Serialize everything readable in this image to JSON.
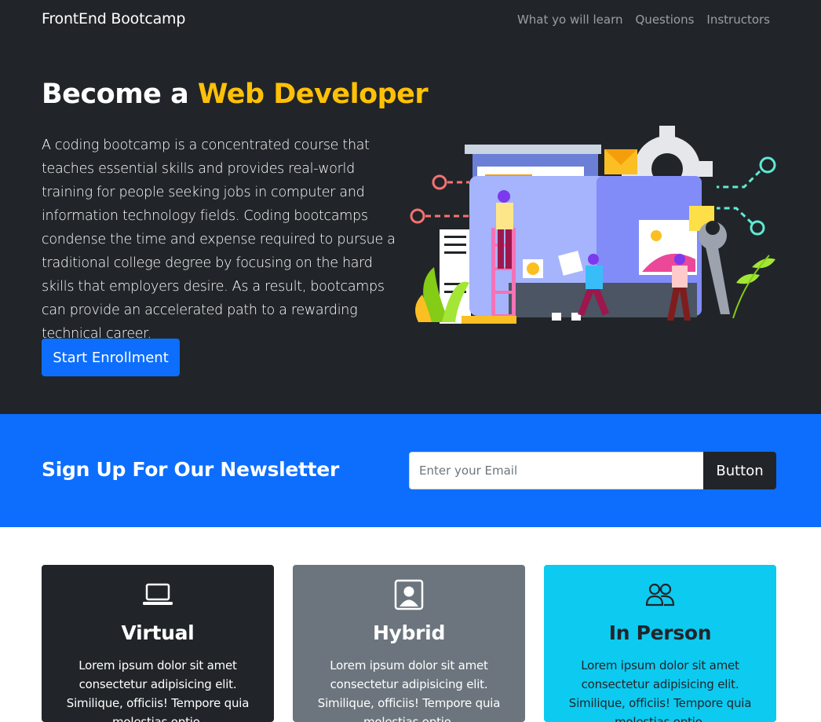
{
  "navbar": {
    "brand": "FrontEnd Bootcamp",
    "links": [
      "What yo will learn",
      "Questions",
      "Instructors"
    ]
  },
  "hero": {
    "title_prefix": "Become a ",
    "title_accent": "Web Developer",
    "lead": "A coding bootcamp is a concentrated course that teaches essential skills and provides real-world training for people seeking jobs in computer and information technology fields. Coding bootcamps condense the time and expense required to pursue a traditional college degree by focusing on the hard skills that employers desire. As a result, bootcamps can provide an accelerated path to a rewarding technical career.",
    "button": "Start Enrollment"
  },
  "newsletter": {
    "title": "Sign Up For Our Newsletter",
    "email_placeholder": "Enter your Email",
    "button": "Button"
  },
  "cards": [
    {
      "title": "Virtual",
      "icon": "laptop-icon",
      "text": "Lorem ipsum dolor sit amet consectetur adipisicing elit. Similique, officiis! Tempore quia molestias optio."
    },
    {
      "title": "Hybrid",
      "icon": "person-badge-icon",
      "text": "Lorem ipsum dolor sit amet consectetur adipisicing elit. Similique, officiis! Tempore quia molestias optio."
    },
    {
      "title": "In Person",
      "icon": "people-icon",
      "text": "Lorem ipsum dolor sit amet consectetur adipisicing elit. Similique, officiis! Tempore quia molestias optio."
    }
  ],
  "colors": {
    "dark": "#212529",
    "primary": "#0d6efd",
    "warning": "#ffc107",
    "secondary": "#6c757d",
    "info": "#0dcaf0"
  }
}
